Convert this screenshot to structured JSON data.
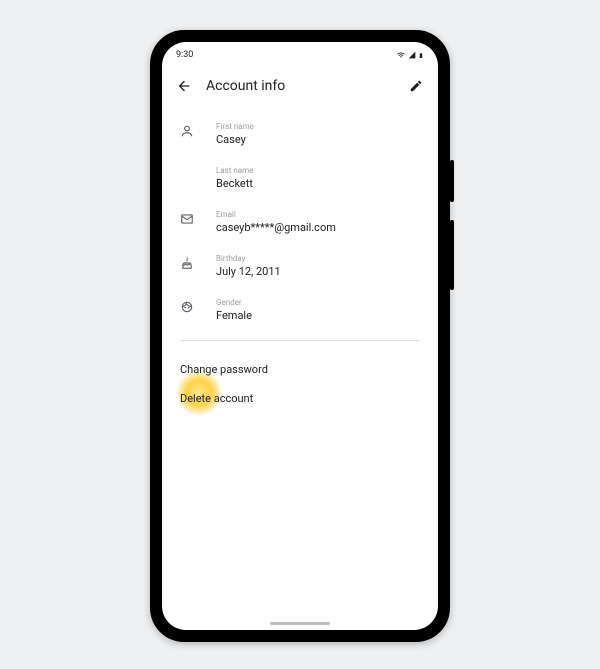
{
  "status": {
    "time": "9:30"
  },
  "header": {
    "title": "Account info"
  },
  "fields": {
    "first_name": {
      "label": "First name",
      "value": "Casey"
    },
    "last_name": {
      "label": "Last name",
      "value": "Beckett"
    },
    "email": {
      "label": "Email",
      "value": "caseyb*****@gmail.com"
    },
    "birthday": {
      "label": "Birthday",
      "value": "July 12, 2011"
    },
    "gender": {
      "label": "Gender",
      "value": "Female"
    }
  },
  "actions": {
    "change_password": "Change password",
    "delete_account": "Delete account"
  }
}
